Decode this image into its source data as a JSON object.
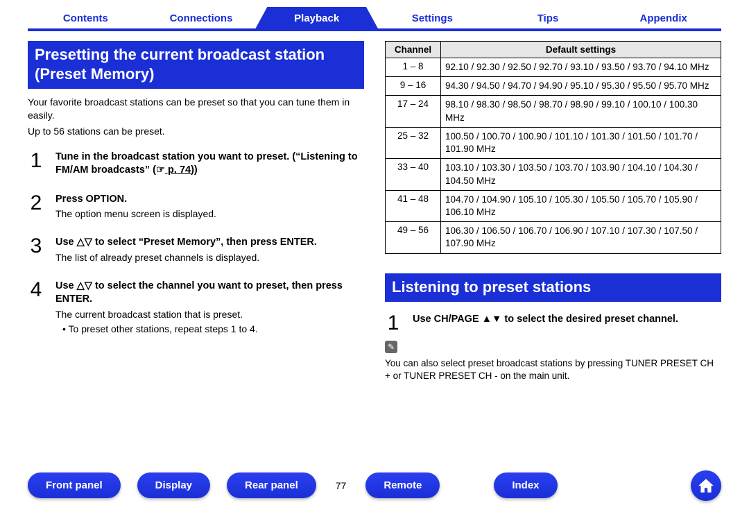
{
  "tabs": {
    "items": [
      "Contents",
      "Connections",
      "Playback",
      "Settings",
      "Tips",
      "Appendix"
    ],
    "active_index": 2
  },
  "left": {
    "heading": "Presetting the current broadcast station (Preset Memory)",
    "intro1": "Your favorite broadcast stations can be preset so that you can tune them in easily.",
    "intro2": "Up to 56 stations can be preset.",
    "steps": [
      {
        "num": "1",
        "bold_pre": "Tune in the broadcast station you want to preset. (“Listening to FM/AM broadcasts” (☞",
        "link": " p. 74",
        "bold_post": "))",
        "desc": "",
        "bullet": ""
      },
      {
        "num": "2",
        "bold_pre": "Press OPTION.",
        "link": "",
        "bold_post": "",
        "desc": "The option menu screen is displayed.",
        "bullet": ""
      },
      {
        "num": "3",
        "bold_pre": "Use △▽ to select “Preset Memory”, then press ENTER.",
        "link": "",
        "bold_post": "",
        "desc": "The list of already preset channels is displayed.",
        "bullet": ""
      },
      {
        "num": "4",
        "bold_pre": "Use △▽ to select the channel you want to preset, then press ENTER.",
        "link": "",
        "bold_post": "",
        "desc": "The current broadcast station that is preset.",
        "bullet": "To preset other stations, repeat steps 1 to 4."
      }
    ]
  },
  "right": {
    "table": {
      "headers": [
        "Channel",
        "Default settings"
      ],
      "rows": [
        {
          "ch": "1 – 8",
          "vals": "92.10 / 92.30 / 92.50 / 92.70 / 93.10 / 93.50 / 93.70 / 94.10 MHz"
        },
        {
          "ch": "9 – 16",
          "vals": "94.30 / 94.50 / 94.70 / 94.90 / 95.10 / 95.30 / 95.50 / 95.70 MHz"
        },
        {
          "ch": "17 – 24",
          "vals": "98.10 / 98.30 / 98.50 / 98.70 / 98.90 / 99.10 / 100.10 / 100.30 MHz"
        },
        {
          "ch": "25 – 32",
          "vals": "100.50 / 100.70 / 100.90 / 101.10 / 101.30 / 101.50 / 101.70 / 101.90 MHz"
        },
        {
          "ch": "33 – 40",
          "vals": "103.10 / 103.30 / 103.50 / 103.70 / 103.90 / 104.10 / 104.30 / 104.50 MHz"
        },
        {
          "ch": "41 – 48",
          "vals": "104.70 / 104.90 / 105.10 / 105.30 / 105.50 / 105.70 / 105.90 / 106.10 MHz"
        },
        {
          "ch": "49 – 56",
          "vals": "106.30 / 106.50 / 106.70 / 106.90 / 107.10 / 107.30 / 107.50 / 107.90 MHz"
        }
      ]
    },
    "heading": "Listening to preset stations",
    "step": {
      "num": "1",
      "bold": "Use CH/PAGE ▲▼ to select the desired preset channel."
    },
    "note_icon": "✎",
    "note_text": "You can also select preset broadcast stations by pressing TUNER PRESET CH + or TUNER PRESET CH - on the main unit."
  },
  "footer": {
    "items": [
      "Front panel",
      "Display",
      "Rear panel",
      "Remote",
      "Index"
    ],
    "page_num": "77"
  }
}
